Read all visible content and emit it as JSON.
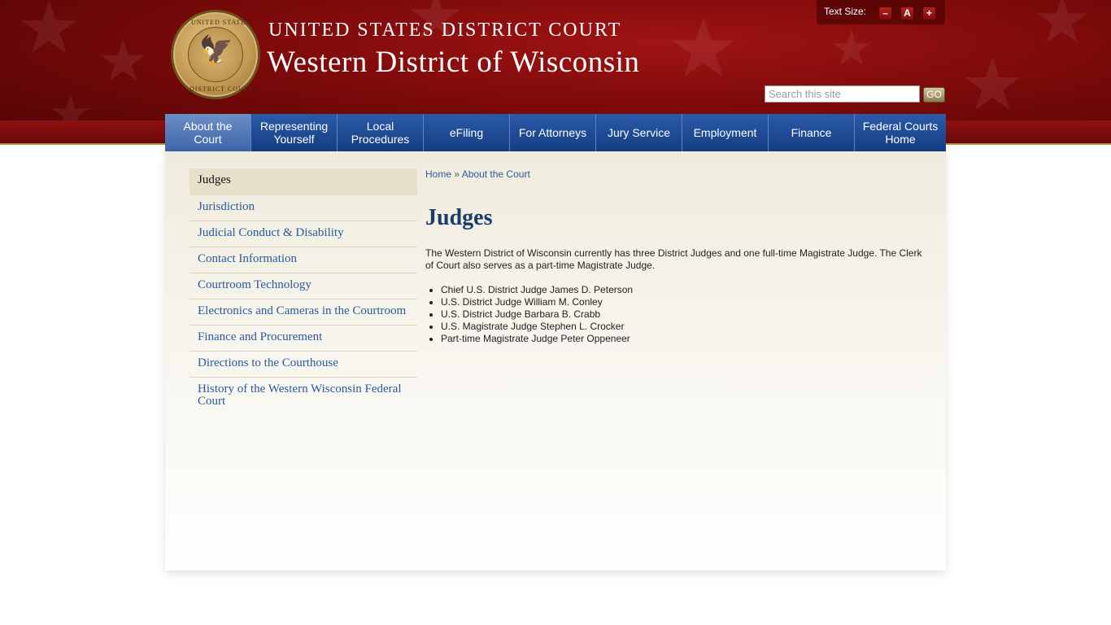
{
  "header": {
    "title_top": "UNITED STATES DISTRICT COURT",
    "title_main": "Western District of Wisconsin",
    "seal_text_top": "UNITED STATES",
    "seal_text_bottom": "DISTRICT COURT"
  },
  "text_size": {
    "label": "Text Size:",
    "decrease": "–",
    "reset": "A",
    "increase": "+"
  },
  "search": {
    "placeholder": "Search this site",
    "value": "",
    "button": "GO"
  },
  "nav": {
    "items": [
      {
        "label": "About the Court"
      },
      {
        "label": "Representing Yourself"
      },
      {
        "label": "Local Procedures"
      },
      {
        "label": "eFiling"
      },
      {
        "label": "For Attorneys"
      },
      {
        "label": "Jury Service"
      },
      {
        "label": "Employment"
      },
      {
        "label": "Finance"
      },
      {
        "label": "Federal Courts Home"
      }
    ]
  },
  "sidebar": {
    "items": [
      {
        "label": "Judges"
      },
      {
        "label": "Jurisdiction"
      },
      {
        "label": "Judicial Conduct & Disability"
      },
      {
        "label": "Contact Information"
      },
      {
        "label": "Courtroom Technology"
      },
      {
        "label": "Electronics and Cameras in the Courtroom"
      },
      {
        "label": "Finance and Procurement"
      },
      {
        "label": "Directions to the Courthouse"
      },
      {
        "label": "History of the Western Wisconsin Federal Court"
      }
    ]
  },
  "breadcrumb": {
    "home": "Home",
    "separator": "»",
    "current": "About the Court"
  },
  "main": {
    "title": "Judges",
    "intro": "The Western District of Wisconsin currently has three District Judges and one full-time Magistrate Judge.  The Clerk of Court also serves as a part-time Magistrate Judge.",
    "judges": [
      "Chief U.S. District Judge James D. Peterson",
      "U.S. District Judge William M. Conley",
      "U.S. District Judge Barbara B. Crabb",
      "U.S. Magistrate Judge Stephen L. Crocker",
      "Part-time Magistrate Judge Peter Oppeneer"
    ]
  }
}
